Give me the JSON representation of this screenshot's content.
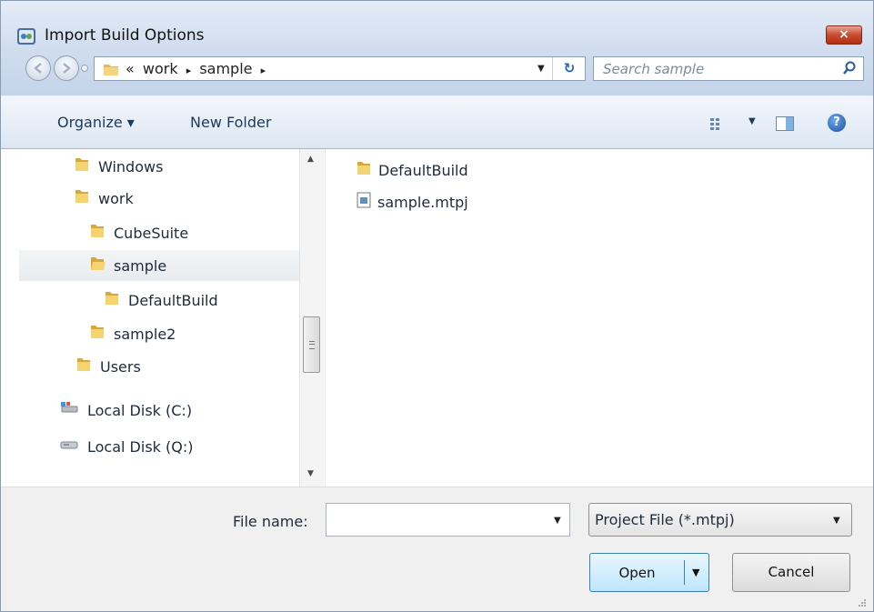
{
  "window": {
    "title": "Import Build Options",
    "icon": "app-icon",
    "close_label": "×"
  },
  "address_bar": {
    "overflow": "«",
    "crumbs": [
      "work",
      "sample"
    ],
    "separator": "▸"
  },
  "search": {
    "placeholder": "Search sample"
  },
  "toolbar": {
    "organize_label": "Organize ▾",
    "new_folder_label": "New Folder"
  },
  "nav_pane": {
    "items": [
      {
        "label": "Windows",
        "icon": "folder-icon"
      },
      {
        "label": "work",
        "icon": "folder-icon"
      },
      {
        "label": "CubeSuite",
        "icon": "folder-icon"
      },
      {
        "label": "sample",
        "icon": "folder-open-icon",
        "selected": true
      },
      {
        "label": "DefaultBuild",
        "icon": "folder-icon"
      },
      {
        "label": "sample2",
        "icon": "folder-icon"
      },
      {
        "label": "Users",
        "icon": "folder-icon"
      },
      {
        "label": "Local Disk (C:)",
        "icon": "system-drive-icon"
      },
      {
        "label": "Local Disk (Q:)",
        "icon": "drive-icon"
      }
    ]
  },
  "file_pane": {
    "items": [
      {
        "label": "DefaultBuild",
        "icon": "folder-icon"
      },
      {
        "label": "sample.mtpj",
        "icon": "project-file-icon"
      }
    ]
  },
  "bottom": {
    "file_name_label": "File name:",
    "file_name_value": "",
    "file_type": "Project File (*.mtpj)",
    "open_label": "Open",
    "cancel_label": "Cancel"
  },
  "colors": {
    "title_gradient": "#cfdcee",
    "selected_row": "#ecefF2",
    "open_button": "#bee6fd",
    "close_button": "#c84b2e"
  }
}
